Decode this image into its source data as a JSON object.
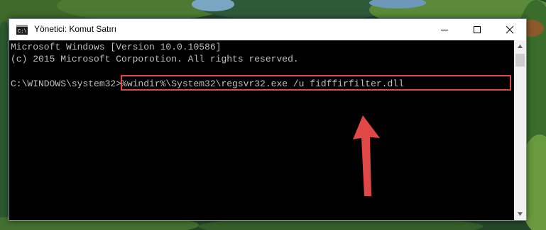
{
  "window": {
    "title": "Yönetici: Komut Satırı",
    "icon": "cmd-console-icon",
    "controls": {
      "minimize": "minimize-icon",
      "maximize": "maximize-icon",
      "close": "close-icon"
    }
  },
  "console": {
    "lines": [
      "Microsoft Windows [Version 10.0.10586]",
      "(c) 2015 Microsoft Corporotion. All rights reserved.",
      "C:\\WINDOWS\\system32>%windir%\\System32\\regsvr32.exe /u fidffirfilter.dll"
    ]
  },
  "annotation": {
    "highlight_color": "#e04848",
    "arrow_color": "#e04848"
  }
}
